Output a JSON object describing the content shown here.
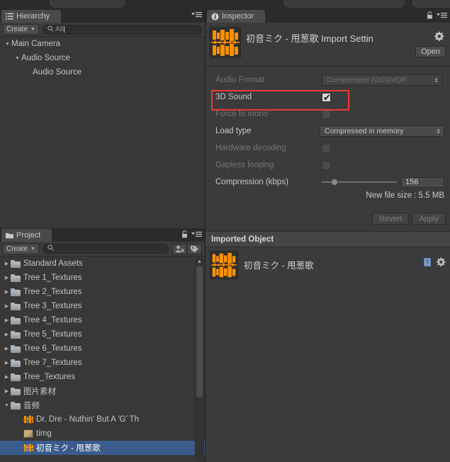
{
  "app": {
    "theme_bg": "#383838",
    "accent_select": "#3a5b8c",
    "highlight_red": "#ec3b38",
    "audio_orange": "#ff9100"
  },
  "hierarchy": {
    "tab_label": "Hierarchy",
    "tab_icon": "list-icon",
    "lock_icon": "lock-icon",
    "menu_icon": "panel-menu-icon",
    "create_label": "Create",
    "create_caret": "▾",
    "search_placeholder": "All",
    "search_value": "",
    "search_icon": "search-icon",
    "items": [
      {
        "label": "Main Camera",
        "indent": 0,
        "arrow": "▼"
      },
      {
        "label": "Audio Source",
        "indent": 1,
        "arrow": "▼"
      },
      {
        "label": "Audio Source",
        "indent": 2,
        "arrow": ""
      }
    ]
  },
  "project": {
    "tab_label": "Project",
    "tab_icon": "folder-icon",
    "lock_icon": "lock-icon",
    "menu_icon": "panel-menu-icon",
    "create_label": "Create",
    "create_caret": "▾",
    "search_placeholder": "",
    "search_value": "",
    "filter_icon": "avatar-filter-icon",
    "label_icon": "tag-icon",
    "scroll_up_arrow": "▲",
    "items": [
      {
        "label": "Standard Assets",
        "type": "folder",
        "arrow": "▶",
        "indent": 0,
        "selected": false
      },
      {
        "label": "Tree 1_Textures",
        "type": "folder",
        "arrow": "▶",
        "indent": 0,
        "selected": false
      },
      {
        "label": "Tree 2_Textures",
        "type": "folder",
        "arrow": "▶",
        "indent": 0,
        "selected": false
      },
      {
        "label": "Tree 3_Textures",
        "type": "folder",
        "arrow": "▶",
        "indent": 0,
        "selected": false
      },
      {
        "label": "Tree 4_Textures",
        "type": "folder",
        "arrow": "▶",
        "indent": 0,
        "selected": false
      },
      {
        "label": "Tree 5_Textures",
        "type": "folder",
        "arrow": "▶",
        "indent": 0,
        "selected": false
      },
      {
        "label": "Tree 6_Textures",
        "type": "folder",
        "arrow": "▶",
        "indent": 0,
        "selected": false
      },
      {
        "label": "Tree 7_Textures",
        "type": "folder",
        "arrow": "▶",
        "indent": 0,
        "selected": false
      },
      {
        "label": "Tree_Textures",
        "type": "folder",
        "arrow": "▶",
        "indent": 0,
        "selected": false
      },
      {
        "label": "图片素材",
        "type": "folder",
        "arrow": "▶",
        "indent": 0,
        "selected": false
      },
      {
        "label": "音频",
        "type": "folder",
        "arrow": "▼",
        "indent": 0,
        "selected": false
      },
      {
        "label": "Dr. Dre - Nuthin' But A 'G' Th",
        "type": "audio",
        "arrow": "",
        "indent": 1,
        "selected": false
      },
      {
        "label": "timg",
        "type": "image",
        "arrow": "",
        "indent": 1,
        "selected": false
      },
      {
        "label": "初音ミク - 甩葱歌",
        "type": "audio",
        "arrow": "",
        "indent": 1,
        "selected": true
      }
    ]
  },
  "inspector": {
    "tab_label": "Inspector",
    "tab_icon": "info-icon",
    "lock_icon": "lock-icon",
    "menu_icon": "panel-menu-icon",
    "asset_icon": "audio-waveform-icon",
    "title": "初音ミク - 甩葱歌 Import Settin",
    "gear_icon": "gear-icon",
    "open_label": "Open",
    "properties": [
      {
        "name": "audio-format",
        "label": "Audio Format",
        "dimmed": true,
        "control": "dropdown",
        "value": "Compressed (OGGVOR",
        "arrow": "⁞"
      },
      {
        "name": "3d-sound",
        "label": "3D Sound",
        "dimmed": false,
        "control": "checkbox",
        "checked": true,
        "highlighted": true
      },
      {
        "name": "force-to-mono",
        "label": "Force to mono",
        "dimmed": true,
        "control": "checkbox",
        "checked": false,
        "highlighted": false
      },
      {
        "name": "load-type",
        "label": "Load type",
        "dimmed": false,
        "control": "dropdown",
        "value": "Compressed in memory",
        "arrow": "⁞"
      },
      {
        "name": "hardware-decoding",
        "label": "Hardware decoding",
        "dimmed": true,
        "control": "checkbox",
        "checked": false,
        "highlighted": false
      },
      {
        "name": "gapless-looping",
        "label": "Gapless looping",
        "dimmed": true,
        "control": "checkbox",
        "checked": false,
        "highlighted": false
      },
      {
        "name": "compression-kbps",
        "label": "Compression (kbps)",
        "dimmed": false,
        "control": "slider",
        "value": "156",
        "slider_percent": 12
      }
    ],
    "new_file_size": "New file size : 5.5 MB",
    "revert_label": "Revert",
    "apply_label": "Apply",
    "imported_object_header": "Imported Object",
    "imported_object_name": "初音ミク - 甩葱歌",
    "imported_help_icon": "book-help-icon",
    "imported_gear_icon": "gear-icon"
  }
}
